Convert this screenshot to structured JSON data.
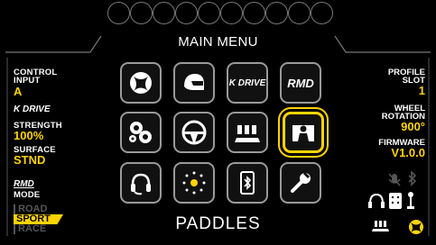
{
  "header": {
    "title": "MAIN MENU",
    "led_count": 10
  },
  "left": {
    "control_input_label": "CONTROL\nINPUT",
    "control_input_value": "A",
    "kdrive_logo": "K DRIVE",
    "strength_label": "STRENGTH",
    "strength_value": "100%",
    "surface_label": "SURFACE",
    "surface_value": "STND",
    "rmd_logo": "RMD",
    "mode_label": "MODE",
    "modes": [
      {
        "label": "ROAD",
        "active": false
      },
      {
        "label": "SPORT",
        "active": true
      },
      {
        "label": "RACE",
        "active": false
      }
    ]
  },
  "right": {
    "profile_label": "PROFILE\nSLOT",
    "profile_value": "1",
    "rotation_label": "WHEEL\nROTATION",
    "rotation_value": "900°",
    "firmware_label": "FIRMWARE",
    "firmware_value": "V1.0.0"
  },
  "grid": [
    {
      "icon": "xbox-icon",
      "selected": false,
      "text": ""
    },
    {
      "icon": "helmet-icon",
      "selected": false,
      "text": ""
    },
    {
      "icon": "kdrive-icon",
      "selected": false,
      "text": "K DRIVE"
    },
    {
      "icon": "rmd-icon",
      "selected": false,
      "text": "RMD"
    },
    {
      "icon": "gears-icon",
      "selected": false,
      "text": ""
    },
    {
      "icon": "steering-wheel-icon",
      "selected": false,
      "text": ""
    },
    {
      "icon": "pedals-icon",
      "selected": false,
      "text": ""
    },
    {
      "icon": "paddles-icon",
      "selected": true,
      "text": ""
    },
    {
      "icon": "headset-icon",
      "selected": false,
      "text": ""
    },
    {
      "icon": "brightness-icon",
      "selected": false,
      "text": ""
    },
    {
      "icon": "bluetooth-phone-icon",
      "selected": false,
      "text": ""
    },
    {
      "icon": "wrench-icon",
      "selected": false,
      "text": ""
    }
  ],
  "footer": {
    "caption": "PADDLES"
  },
  "colors": {
    "accent": "#ffd400",
    "tile_border": "#9a9a9a"
  }
}
